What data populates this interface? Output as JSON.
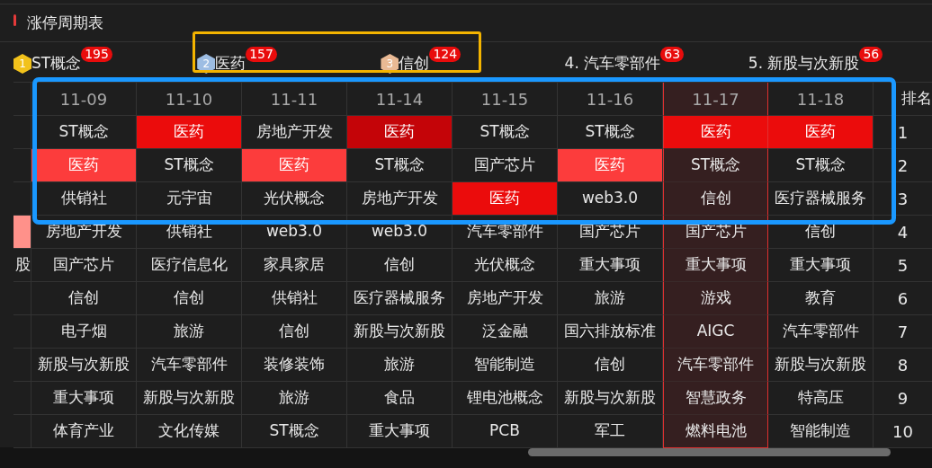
{
  "title": "涨停周期表",
  "top_items": [
    {
      "kind": "medal",
      "rank": "1",
      "color": "#f2c21b",
      "label": "ST概念",
      "count": "195",
      "outlined": false
    },
    {
      "kind": "medal",
      "rank": "2",
      "color": "#9dbde3",
      "label": "医药",
      "count": "157",
      "outlined": true
    },
    {
      "kind": "medal",
      "rank": "3",
      "color": "#e9b994",
      "label": "信创",
      "count": "124",
      "outlined": true
    },
    {
      "kind": "plain",
      "label": "4. 汽车零部件",
      "count": "63",
      "outlined": false
    },
    {
      "kind": "plain",
      "label": "5. 新股与次新股",
      "count": "56",
      "outlined": false
    }
  ],
  "table": {
    "columns": [
      {
        "label": "11-09",
        "selected": false
      },
      {
        "label": "11-10",
        "selected": false
      },
      {
        "label": "11-11",
        "selected": false
      },
      {
        "label": "11-14",
        "selected": false
      },
      {
        "label": "11-15",
        "selected": false
      },
      {
        "label": "11-16",
        "selected": false
      },
      {
        "label": "11-17",
        "selected": true
      },
      {
        "label": "11-18",
        "selected": false
      }
    ],
    "rank_header": "排名",
    "rows": [
      {
        "rank": "1",
        "outlined": true,
        "edge": {},
        "cells": [
          {
            "text": "ST概念"
          },
          {
            "text": "医药",
            "color": "#eb0c0c"
          },
          {
            "text": "房地产开发"
          },
          {
            "text": "医药",
            "color": "#c40408"
          },
          {
            "text": "ST概念"
          },
          {
            "text": "ST概念"
          },
          {
            "text": "医药",
            "color": "#eb0c0c"
          },
          {
            "text": "医药",
            "color": "#eb0c0c"
          }
        ]
      },
      {
        "rank": "2",
        "outlined": true,
        "edge": {},
        "cells": [
          {
            "text": "医药",
            "color": "#fc3c3c"
          },
          {
            "text": "ST概念"
          },
          {
            "text": "医药",
            "color": "#fc3c3c"
          },
          {
            "text": "ST概念"
          },
          {
            "text": "国产芯片"
          },
          {
            "text": "医药",
            "color": "#fc3c3c"
          },
          {
            "text": "ST概念"
          },
          {
            "text": "ST概念"
          }
        ]
      },
      {
        "rank": "3",
        "outlined": true,
        "edge": {},
        "cells": [
          {
            "text": "供销社"
          },
          {
            "text": "元宇宙"
          },
          {
            "text": "光伏概念"
          },
          {
            "text": "房地产开发"
          },
          {
            "text": "医药",
            "color": "#eb0c0c"
          },
          {
            "text": "web3.0"
          },
          {
            "text": "信创"
          },
          {
            "text": "医疗器械服务"
          }
        ]
      },
      {
        "rank": "4",
        "outlined": false,
        "edge": {
          "color": "#ff918a"
        },
        "cells": [
          {
            "text": "房地产开发"
          },
          {
            "text": "供销社"
          },
          {
            "text": "web3.0"
          },
          {
            "text": "web3.0"
          },
          {
            "text": "汽车零部件"
          },
          {
            "text": "国产芯片"
          },
          {
            "text": "国产芯片"
          },
          {
            "text": "信创"
          }
        ]
      },
      {
        "rank": "5",
        "outlined": false,
        "edge": {
          "text": "股"
        },
        "cells": [
          {
            "text": "国产芯片"
          },
          {
            "text": "医疗信息化"
          },
          {
            "text": "家具家居"
          },
          {
            "text": "信创"
          },
          {
            "text": "光伏概念"
          },
          {
            "text": "重大事项"
          },
          {
            "text": "重大事项"
          },
          {
            "text": "重大事项"
          }
        ]
      },
      {
        "rank": "6",
        "outlined": false,
        "edge": {},
        "cells": [
          {
            "text": "信创"
          },
          {
            "text": "信创"
          },
          {
            "text": "供销社"
          },
          {
            "text": "医疗器械服务"
          },
          {
            "text": "房地产开发"
          },
          {
            "text": "旅游"
          },
          {
            "text": "游戏"
          },
          {
            "text": "教育"
          }
        ]
      },
      {
        "rank": "7",
        "outlined": false,
        "edge": {},
        "cells": [
          {
            "text": "电子烟"
          },
          {
            "text": "旅游"
          },
          {
            "text": "信创"
          },
          {
            "text": "新股与次新股"
          },
          {
            "text": "泛金融"
          },
          {
            "text": "国六排放标准"
          },
          {
            "text": "AIGC"
          },
          {
            "text": "汽车零部件"
          }
        ]
      },
      {
        "rank": "8",
        "outlined": false,
        "edge": {},
        "cells": [
          {
            "text": "新股与次新股"
          },
          {
            "text": "汽车零部件"
          },
          {
            "text": "装修装饰"
          },
          {
            "text": "旅游"
          },
          {
            "text": "智能制造"
          },
          {
            "text": "信创"
          },
          {
            "text": "汽车零部件"
          },
          {
            "text": "新股与次新股"
          }
        ]
      },
      {
        "rank": "9",
        "outlined": false,
        "edge": {},
        "cells": [
          {
            "text": "重大事项"
          },
          {
            "text": "新股与次新股"
          },
          {
            "text": "旅游"
          },
          {
            "text": "食品"
          },
          {
            "text": "锂电池概念"
          },
          {
            "text": "新股与次新股"
          },
          {
            "text": "智慧政务"
          },
          {
            "text": "特高压"
          }
        ]
      },
      {
        "rank": "10",
        "outlined": false,
        "edge": {},
        "cells": [
          {
            "text": "体育产业"
          },
          {
            "text": "文化传媒"
          },
          {
            "text": "ST概念"
          },
          {
            "text": "重大事项"
          },
          {
            "text": "PCB"
          },
          {
            "text": "军工"
          },
          {
            "text": "燃料电池"
          },
          {
            "text": "智能制造"
          }
        ]
      }
    ]
  }
}
